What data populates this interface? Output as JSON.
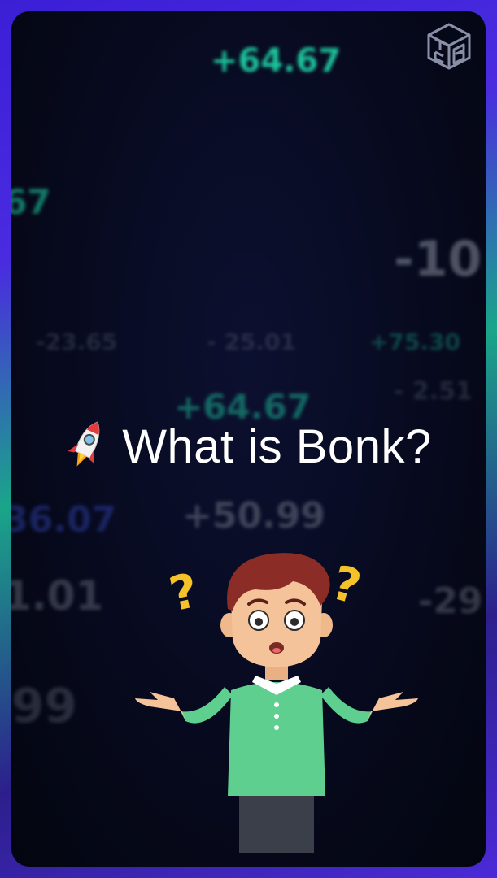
{
  "title": "What is Bonk?",
  "icons": {
    "title_icon": "rocket-icon",
    "logo": "tcb-logo"
  },
  "background_numbers": [
    "+64.67",
    "67",
    "-10",
    "+64.67",
    "+50.99",
    "1.01",
    "99",
    "-29",
    "36.07",
    "-23.65",
    "- 25.01",
    "+75.30",
    "- 2.51"
  ],
  "colors": {
    "accent_green": "#1fd3a6",
    "border_purple": "#4a2be0",
    "shirt_green": "#5ecf8e"
  }
}
